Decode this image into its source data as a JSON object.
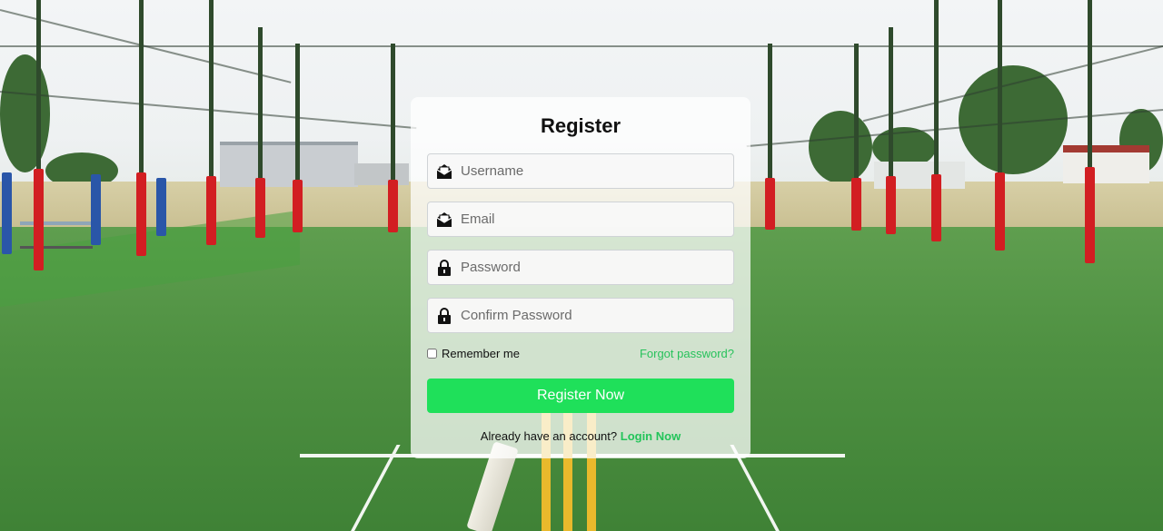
{
  "form": {
    "title": "Register",
    "username_placeholder": "Username",
    "email_placeholder": "Email",
    "password_placeholder": "Password",
    "confirm_password_placeholder": "Confirm Password",
    "remember_label": "Remember me",
    "forgot_label": "Forgot password?",
    "submit_label": "Register Now",
    "login_prompt": "Already have an account?",
    "login_link": "Login Now"
  },
  "icons": {
    "username": "envelope-open-icon",
    "email": "envelope-open-icon",
    "password": "lock-icon",
    "confirm_password": "lock-icon"
  },
  "colors": {
    "accent": "#1fe05a",
    "link": "#27c25b",
    "card": "rgba(255,255,255,0.74)"
  }
}
